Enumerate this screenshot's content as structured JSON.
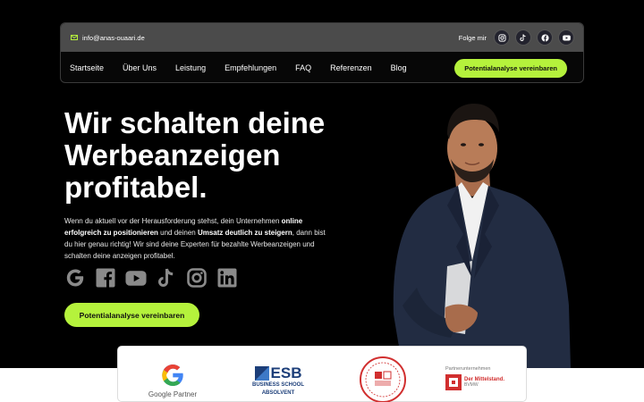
{
  "topbar": {
    "email": "info@anas-ouaari.de",
    "follow_label": "Folge mir",
    "social_icons": [
      "instagram-icon",
      "tiktok-icon",
      "facebook-icon",
      "youtube-icon"
    ]
  },
  "nav": {
    "items": [
      "Startseite",
      "Über Uns",
      "Leistung",
      "Empfehlungen",
      "FAQ",
      "Referenzen",
      "Blog"
    ],
    "cta": "Potentialanalyse vereinbaren"
  },
  "hero": {
    "title_line1": "Wir schalten deine",
    "title_line2": "Werbeanzeigen",
    "title_line3": "profitabel.",
    "text_part1": "Wenn du aktuell vor der Herausforderung stehst, dein Unternehmen ",
    "text_bold1": "online erfolgreich zu positionieren",
    "text_part2": " und deinen ",
    "text_bold2": "Umsatz deutlich zu steigern",
    "text_part3": ", dann bist du hier genau richtig! Wir sind deine Experten für bezahlte Werbeanzeigen und schalten deine anzeigen profitabel.",
    "platform_icons": [
      "google-icon",
      "facebook-icon",
      "youtube-icon",
      "tiktok-icon",
      "instagram-icon",
      "linkedin-icon"
    ],
    "cta": "Potentialanalyse vereinbaren"
  },
  "partners": {
    "google_label": "Google Partner",
    "esb_name": "ESB",
    "esb_sub": "BUSINESS SCHOOL",
    "esb_absolvent": "ABSOLVENT",
    "mittelstand_label": "Partnerunternehmen",
    "mittelstand_name": "Der Mittelstand.",
    "mittelstand_sub": "BVMW"
  },
  "colors": {
    "accent": "#b5f23c",
    "background": "#000000",
    "topbar": "#4b4b4b"
  }
}
